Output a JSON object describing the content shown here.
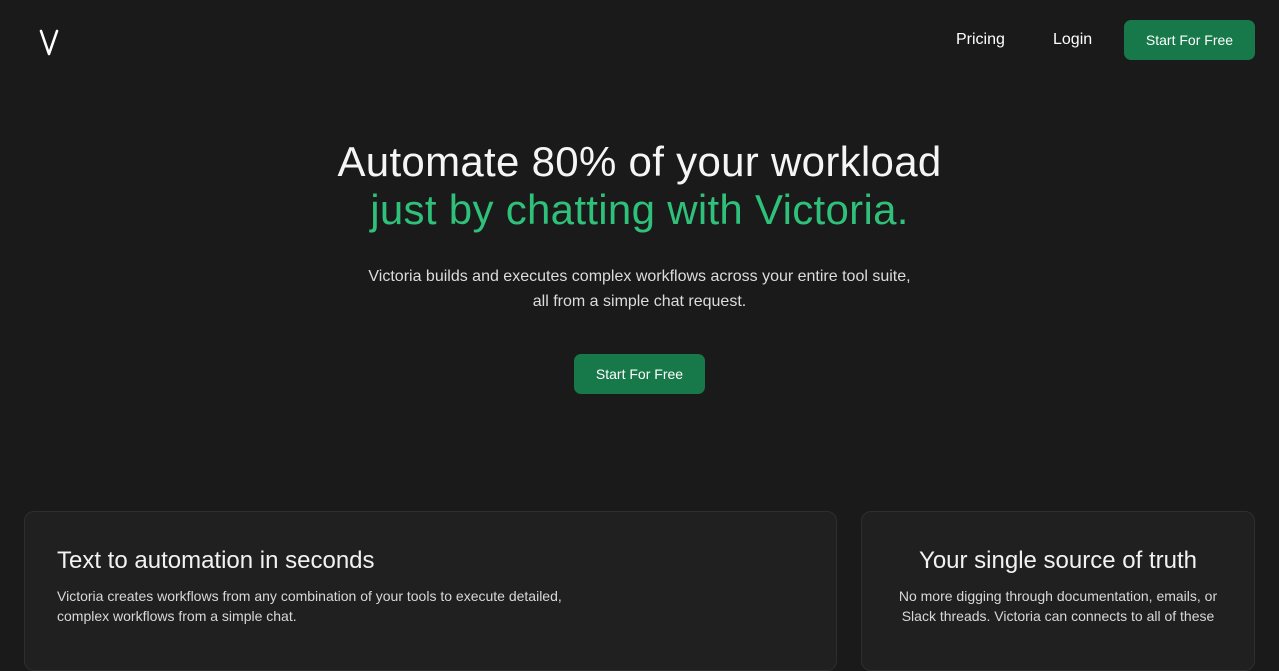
{
  "nav": {
    "logo_alt": "Victoria logo",
    "links": {
      "pricing": "Pricing",
      "login": "Login"
    },
    "cta": "Start For Free"
  },
  "hero": {
    "title_line1": "Automate 80% of your workload",
    "title_line2": "just by chatting with Victoria.",
    "subtitle_line1": "Victoria builds and executes complex workflows across your entire tool suite,",
    "subtitle_line2": "all from a simple chat request.",
    "cta": "Start For Free"
  },
  "features": [
    {
      "title": "Text to automation in seconds",
      "description": "Victoria creates workflows from any combination of your tools to execute detailed, complex workflows from a simple chat."
    },
    {
      "title": "Your single source of truth",
      "description": "No more digging through documentation, emails, or Slack threads. Victoria can connects to all of these"
    }
  ],
  "colors": {
    "background": "#1a1a1a",
    "accent_text": "#2fc07a",
    "button": "#17784a",
    "card": "#202020"
  }
}
